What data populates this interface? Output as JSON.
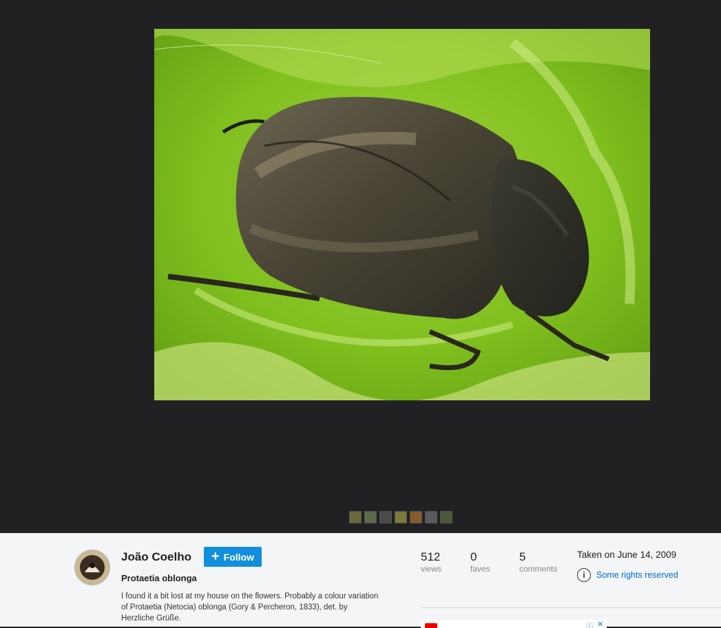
{
  "photo": {
    "alt": "Protaetia oblonga beetle on a green leaf"
  },
  "filmstrip": {
    "thumbnails": [
      {
        "color": "#6a6a3a"
      },
      {
        "color": "#5a6a4a"
      },
      {
        "color": "#4a4a4a"
      },
      {
        "color": "#7a7a3a"
      },
      {
        "color": "#8a5a2a"
      },
      {
        "color": "#5a5a5a"
      },
      {
        "color": "#4a5a3a"
      }
    ]
  },
  "author": {
    "name": "João Coelho",
    "follow_label": "Follow"
  },
  "photo_info": {
    "title": "Protaetia oblonga",
    "description": "I found it a bit lost at my house on the flowers. Probably a colour variation of Protaetia (Netocia) oblonga (Gory & Percheron, 1833), det. by Herzliche Grüße."
  },
  "stats": {
    "views": {
      "value": "512",
      "label": "views"
    },
    "faves": {
      "value": "0",
      "label": "faves"
    },
    "comments": {
      "value": "5",
      "label": "comments"
    }
  },
  "taken": "Taken on June 14, 2009",
  "license": {
    "label": "Some rights reserved",
    "icon": "creative-commons-attribution-icon"
  },
  "colors": {
    "viewer_bg": "#212124",
    "info_bg": "#f3f5f6",
    "follow_bg": "#128fdc",
    "link": "#006add"
  }
}
